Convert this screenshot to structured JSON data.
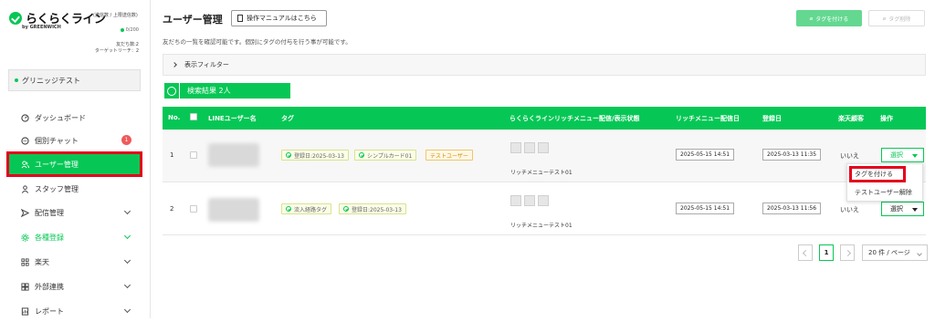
{
  "brand": {
    "name": "らくらくライン",
    "sub": "by GREENWICH",
    "note": "(送信数 / 上限送信数)",
    "count": "0/200",
    "friends": "友だち数:2",
    "target_reach": "ターゲットリーチ：2"
  },
  "account": "グリニッジテスト",
  "nav": [
    {
      "label": "ダッシュボード",
      "icon": "dashboard-icon"
    },
    {
      "label": "個別チャット",
      "icon": "chat-icon",
      "badge": "1"
    },
    {
      "label": "ユーザー管理",
      "icon": "users-icon"
    },
    {
      "label": "スタッフ管理",
      "icon": "staff-icon"
    },
    {
      "label": "配信管理",
      "icon": "send-icon"
    },
    {
      "label": "各種登録",
      "icon": "gear-icon"
    },
    {
      "label": "楽天",
      "icon": "rakuten-icon"
    },
    {
      "label": "外部連携",
      "icon": "link-icon"
    },
    {
      "label": "レポート",
      "icon": "report-icon"
    }
  ],
  "page": {
    "title": "ユーザー管理",
    "manual_button": "操作マニュアルはこちら",
    "tag_add_button": "タグを付ける",
    "tag_delete_button": "タグ削除",
    "description": "友だちの一覧を確認可能です。個別にタグの付与を行う事が可能です。",
    "filter_label": "表示フィルター",
    "result_label": "検索結果 2人"
  },
  "table": {
    "headers": [
      "No.",
      "LINEユーザー名",
      "タグ",
      "らくらくラインリッチメニュー配信/表示状態",
      "リッチメニュー配信日",
      "登録日",
      "楽天顧客",
      "操作"
    ],
    "rows": [
      {
        "no": "1",
        "tags": [
          "登録日:2025-03-13",
          "シンプルカード01",
          "テストユーザー"
        ],
        "rich_menu": "リッチメニューテスト01",
        "rich_date": "2025-05-15 14:51",
        "registered": "2025-03-13 11:35",
        "rakuten": "いいえ",
        "action": "選択"
      },
      {
        "no": "2",
        "tags": [
          "流入経路タグ",
          "登録日:2025-03-13"
        ],
        "rich_menu": "リッチメニューテスト01",
        "rich_date": "2025-05-15 14:51",
        "registered": "2025-03-13 11:56",
        "rakuten": "いいえ",
        "action": "選択"
      }
    ]
  },
  "dropdown": [
    "タグを付ける",
    "テストユーザー解除"
  ],
  "pagination": {
    "current": "1",
    "per_page": "20 件 / ページ"
  },
  "colors": {
    "accent": "#06c755",
    "highlight": "#e3001b",
    "badge": "#f05a5a"
  }
}
